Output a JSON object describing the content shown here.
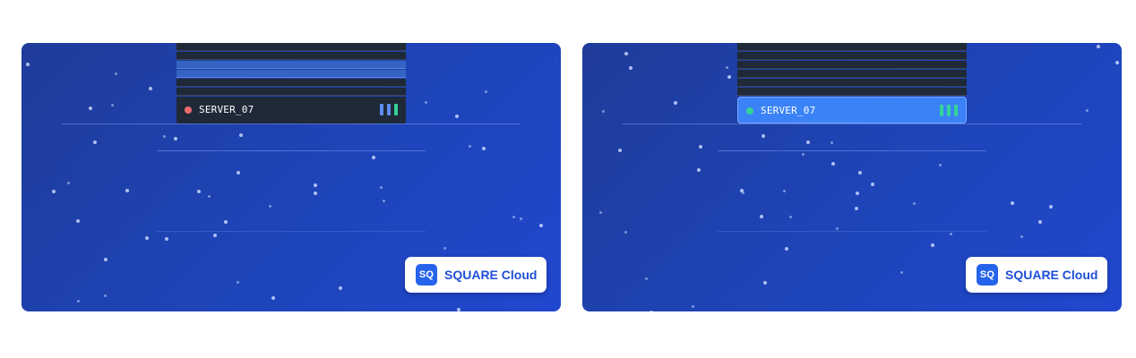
{
  "panels": [
    {
      "id": "left",
      "server": {
        "name": "SERVER_07",
        "status_color": "#ef6b6b",
        "bar_colors": [
          "#5b8ef0",
          "#5b8ef0",
          "#34d399"
        ]
      },
      "brand": {
        "logo": "SQ",
        "name": "SQUARE Cloud"
      }
    },
    {
      "id": "right",
      "server": {
        "name": "SERVER_07",
        "status_color": "#34d399",
        "bar_colors": [
          "#34d399",
          "#34d399",
          "#34d399"
        ]
      },
      "brand": {
        "logo": "SQ",
        "name": "SQUARE Cloud"
      }
    }
  ],
  "colors": {
    "background_start": "#1f3c9a",
    "background_end": "#2147cf",
    "rack_slot": "#1f2937",
    "highlight_slot": "#3563c4",
    "active_row_selected": "#3b82f6",
    "brand_text": "#1d4ed8",
    "brand_logo_bg": "#2563eb"
  }
}
